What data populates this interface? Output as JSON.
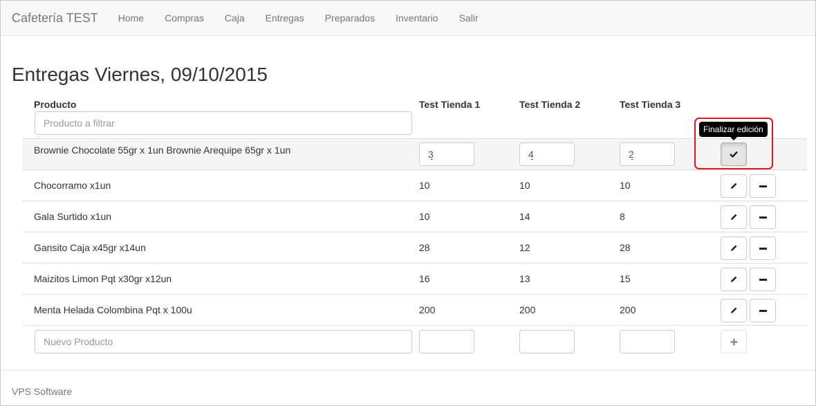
{
  "navbar": {
    "brand": "Cafetería TEST",
    "items": [
      {
        "label": "Home"
      },
      {
        "label": "Compras"
      },
      {
        "label": "Caja"
      },
      {
        "label": "Entregas"
      },
      {
        "label": "Preparados"
      },
      {
        "label": "Inventario"
      },
      {
        "label": "Salir"
      }
    ]
  },
  "page": {
    "title": "Entregas Viernes, 09/10/2015"
  },
  "table": {
    "headers": {
      "product": "Producto",
      "store1": "Test Tienda 1",
      "store2": "Test Tienda 2",
      "store3": "Test Tienda 3"
    },
    "filter_placeholder": "Producto a filtrar",
    "editing_row": {
      "product": "Brownie Chocolate 55gr x 1un Brownie Arequipe 65gr x 1un",
      "store1": "3",
      "store2": "4",
      "store3": "2",
      "finish_tooltip": "Finalizar edición"
    },
    "rows": [
      {
        "product": "Chocorramo x1un",
        "store1": "10",
        "store2": "10",
        "store3": "10"
      },
      {
        "product": "Gala Surtido x1un",
        "store1": "10",
        "store2": "14",
        "store3": "8"
      },
      {
        "product": "Gansito Caja x45gr x14un",
        "store1": "28",
        "store2": "12",
        "store3": "28"
      },
      {
        "product": "Maizitos Limon Pqt x30gr x12un",
        "store1": "16",
        "store2": "13",
        "store3": "15"
      },
      {
        "product": "Menta Helada Colombina Pqt x 100u",
        "store1": "200",
        "store2": "200",
        "store3": "200"
      }
    ],
    "new_product_placeholder": "Nuevo Producto"
  },
  "footer": {
    "text": "VPS Software"
  },
  "colors": {
    "highlight": "#e8141c",
    "navbar_bg": "#f8f8f8"
  },
  "icons": {
    "edit": "pencil-icon",
    "remove": "minus-icon",
    "finish": "check-icon",
    "add": "plus-icon"
  }
}
